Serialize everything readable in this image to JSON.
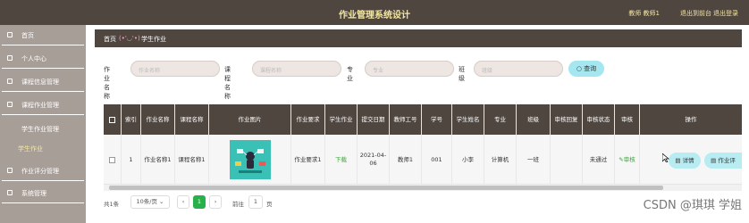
{
  "header": {
    "title": "作业管理系统设计",
    "user": "教师 教师1",
    "back_label": "退出到前台",
    "logout_label": "退出登录"
  },
  "sidebar": {
    "items": [
      {
        "label": "首页"
      },
      {
        "label": "个人中心"
      },
      {
        "label": "课程信息管理"
      },
      {
        "label": "课程作业管理"
      },
      {
        "label": "学生作业管理"
      },
      {
        "label": "学生作业"
      },
      {
        "label": "作业评分管理"
      },
      {
        "label": "系统管理"
      }
    ]
  },
  "breadcrumb": {
    "home": "首页",
    "separator": "(•'◡'•)",
    "current": "学生作业"
  },
  "search": {
    "fields": [
      {
        "label": "作业名称",
        "placeholder": "作业名称"
      },
      {
        "label": "课程名称",
        "placeholder": "课程名称"
      },
      {
        "label": "专业",
        "placeholder": "专业"
      },
      {
        "label": "班级",
        "placeholder": "班级"
      }
    ],
    "button_label": "查询",
    "button_icon": "search-icon"
  },
  "table": {
    "columns": [
      "索引",
      "作业名称",
      "课程名称",
      "作业图片",
      "作业要求",
      "学生作业",
      "提交日期",
      "教师工号",
      "学号",
      "学生姓名",
      "专业",
      "班级",
      "审核回复",
      "审核状态",
      "审核",
      "操作"
    ],
    "rows": [
      {
        "index": "1",
        "homework_name": "作业名称1",
        "course_name": "课程名称1",
        "requirement": "作业要求1",
        "student_work": "下载",
        "submit_date": "2021-04-06",
        "teacher_id": "教师1",
        "student_id": "001",
        "student_name": "小李",
        "major": "计算机",
        "class": "一班",
        "review_reply": "",
        "review_status": "未通过",
        "review_action": "审核",
        "detail_label": "详情",
        "grade_label": "作业评"
      }
    ]
  },
  "pager": {
    "total": "共1条",
    "page_size": "10条/页",
    "current_page": "1",
    "goto_label": "前往",
    "goto_value": "1",
    "page_suffix": "页"
  },
  "watermark": "CSDN @琪琪 学姐",
  "colors": {
    "header_bg": "#4f4640",
    "sidebar_bg": "#a89e98",
    "accent_button": "#a5e7f0",
    "pager_active": "#29b04a"
  }
}
